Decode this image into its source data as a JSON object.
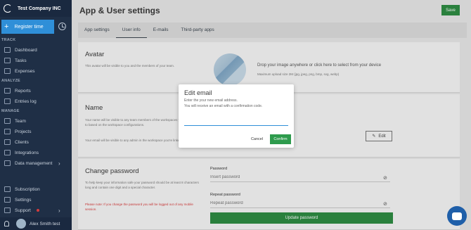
{
  "sidebar": {
    "company": "Test Company INC",
    "register_label": "Register time",
    "sections": {
      "track": "TRACK",
      "analyze": "ANALYZE",
      "manage": "MANAGE"
    },
    "items": [
      {
        "label": "Dashboard"
      },
      {
        "label": "Tasks"
      },
      {
        "label": "Expenses"
      },
      {
        "label": "Reports"
      },
      {
        "label": "Entries log"
      },
      {
        "label": "Team"
      },
      {
        "label": "Projects"
      },
      {
        "label": "Clients"
      },
      {
        "label": "Integrations"
      },
      {
        "label": "Data management"
      },
      {
        "label": "Subscription"
      },
      {
        "label": "Settings"
      },
      {
        "label": "Support"
      }
    ],
    "user": "Alex Smith test"
  },
  "header": {
    "title": "App & User settings",
    "save_label": "Save"
  },
  "tabs": [
    "App settings",
    "User info",
    "E-mails",
    "Third-party apps"
  ],
  "avatar_card": {
    "title": "Avatar",
    "desc": "This avatar will be visible to you and the members of your team.",
    "drop_text": "Drop your image anywhere or click here to select from your device",
    "upload_hint": "Maximum upload size 2M (jpg, jpeg, png, bmp, svg, webp)"
  },
  "name_card": {
    "title": "Name",
    "desc1": "Your name will be visible to any team members of the workspaces you're linked to based on the workspace configurations.",
    "desc2": "Your email will be visible to any admin in the workspace you're linked to.",
    "edit_label": "Edit"
  },
  "password_card": {
    "title": "Change password",
    "desc": "To help keep your information safe your password should be at least 8 characters long and contain one digit and a special character.",
    "note": "Please note: If you change the password you will be logged out of any mobile session.",
    "password_label": "Password",
    "password_placeholder": "Insert password",
    "repeat_label": "Repeat password",
    "repeat_placeholder": "Repeat password",
    "update_label": "Update password"
  },
  "modal": {
    "title": "Edit email",
    "line1": "Enter the your new email address.",
    "line2": "You will receive an email with a confirmation code.",
    "input_value": "",
    "cancel_label": "Cancel",
    "confirm_label": "Confirm"
  },
  "colors": {
    "sidebar": "#1f2f46",
    "accent": "#2f8fd8",
    "success": "#2e8b43",
    "danger": "#d63c3c"
  }
}
